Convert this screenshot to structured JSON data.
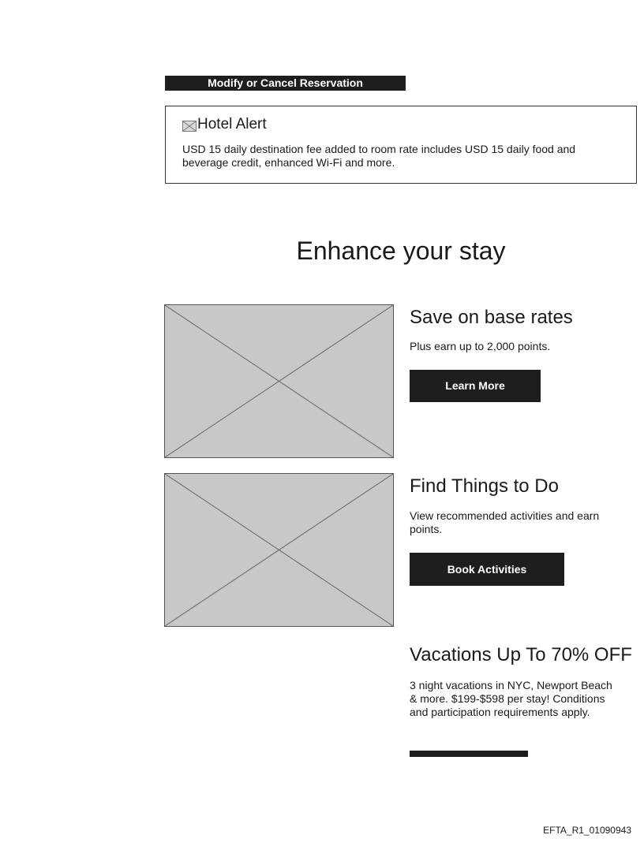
{
  "reservation": {
    "modify_label": "Modify or Cancel Reservation"
  },
  "alert": {
    "icon": "broken-image-icon",
    "title": "Hotel Alert",
    "text": "USD 15 daily destination fee added to room rate includes USD 15 daily food and beverage credit, enhanced Wi-Fi and more."
  },
  "enhance": {
    "title": "Enhance your stay",
    "promos": [
      {
        "title": "Save on base rates",
        "description": "Plus earn up to 2,000 points.",
        "button_label": "Learn More"
      },
      {
        "title": "Find Things to Do",
        "description": "View recommended activities and earn points.",
        "button_label": "Book Activities"
      },
      {
        "title": "Vacations Up To 70% OFF",
        "description": "3 night vacations in NYC, Newport Beach & more. $199-$598 per stay! Conditions and participation requirements apply.",
        "button_label": ""
      }
    ]
  },
  "footer": {
    "document_id": "EFTA_R1_01090943"
  },
  "colors": {
    "button_bg": "#1e1e1e",
    "button_text": "#ffffff",
    "placeholder_bg": "#c8c8c8",
    "border": "#333333"
  }
}
